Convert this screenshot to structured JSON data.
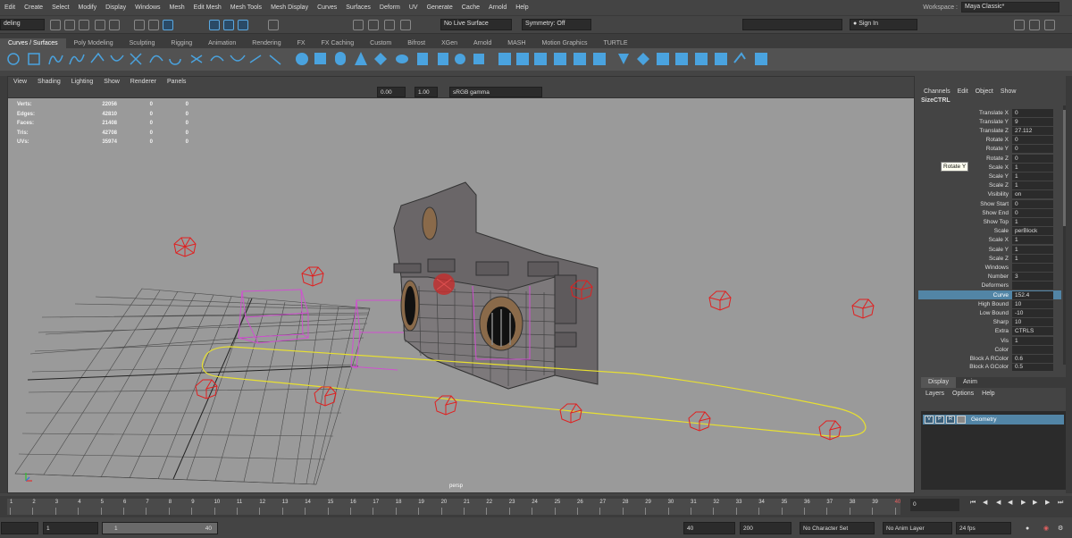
{
  "menus": [
    "Edit",
    "Create",
    "Select",
    "Modify",
    "Display",
    "Windows",
    "Mesh",
    "Edit Mesh",
    "Mesh Tools",
    "Mesh Display",
    "Curves",
    "Surfaces",
    "Deform",
    "UV",
    "Generate",
    "Cache",
    "Arnold",
    "Help"
  ],
  "workspace": {
    "label": "Workspace :",
    "value": "Maya Classic*"
  },
  "status": {
    "menuset": "deling",
    "live": "No Live Surface",
    "symmetry": "Symmetry: Off",
    "signin": "Sign In"
  },
  "shelf_tabs": [
    "Curves / Surfaces",
    "Poly Modeling",
    "Sculpting",
    "Rigging",
    "Animation",
    "Rendering",
    "FX",
    "FX Caching",
    "Custom",
    "Bifrost",
    "XGen",
    "Arnold",
    "MASH",
    "Motion Graphics",
    "TURTLE"
  ],
  "viewport": {
    "menus": [
      "View",
      "Shading",
      "Lighting",
      "Show",
      "Renderer",
      "Panels"
    ],
    "gamma_a": "0.00",
    "gamma_b": "1.00",
    "colorspace": "sRGB gamma",
    "hud": [
      [
        "Verts:",
        "22056",
        "0",
        "0"
      ],
      [
        "Edges:",
        "42810",
        "0",
        "0"
      ],
      [
        "Faces:",
        "21408",
        "0",
        "0"
      ],
      [
        "Tris:",
        "42708",
        "0",
        "0"
      ],
      [
        "UVs:",
        "35974",
        "0",
        "0"
      ]
    ],
    "camera": "persp"
  },
  "channelbox": {
    "menus": [
      "Channels",
      "Edit",
      "Object",
      "Show"
    ],
    "object": "SizeCTRL",
    "attrs": [
      [
        "Translate X",
        "0"
      ],
      [
        "Translate Y",
        "9"
      ],
      [
        "Translate Z",
        "27.112"
      ],
      [
        "Rotate X",
        "0"
      ],
      [
        "Rotate Y",
        "0"
      ],
      [
        "Rotate Z",
        "0"
      ],
      [
        "Scale X",
        "1"
      ],
      [
        "Scale Y",
        "1"
      ],
      [
        "Scale Z",
        "1"
      ],
      [
        "Visibility",
        "on"
      ],
      [
        "Show Start",
        "0"
      ],
      [
        "Show End",
        "0"
      ],
      [
        "Show Top",
        "1"
      ],
      [
        "Scale",
        "perBlock"
      ],
      [
        "Scale X",
        "1"
      ],
      [
        "Scale Y",
        "1"
      ],
      [
        "Scale Z",
        "1"
      ],
      [
        "Windows",
        ""
      ],
      [
        "Number",
        "3"
      ],
      [
        "Deformers",
        ""
      ],
      [
        "Curve",
        "152.4"
      ],
      [
        "High Bound",
        "10"
      ],
      [
        "Low Bound",
        "-10"
      ],
      [
        "Sharp",
        "10"
      ],
      [
        "Extra",
        "CTRLS"
      ],
      [
        "Vis",
        "1"
      ],
      [
        "Color",
        ""
      ],
      [
        "Block A RColor",
        "0.6"
      ],
      [
        "Block A GColor",
        "0.5"
      ]
    ],
    "tooltip": "Rotate Y"
  },
  "layers": {
    "tabs": [
      "Display",
      "Anim"
    ],
    "menus": [
      "Layers",
      "Options",
      "Help"
    ],
    "row": {
      "v": "V",
      "p": "P",
      "r": "R",
      "name": "Geometry"
    }
  },
  "timeline": {
    "ticks": [
      "1",
      "2",
      "3",
      "4",
      "5",
      "6",
      "7",
      "8",
      "9",
      "10",
      "11",
      "12",
      "13",
      "14",
      "15",
      "16",
      "17",
      "18",
      "19",
      "20",
      "21",
      "22",
      "23",
      "24",
      "25",
      "26",
      "27",
      "28",
      "29",
      "30",
      "31",
      "32",
      "33",
      "34",
      "35",
      "36",
      "37",
      "38",
      "39",
      "40"
    ],
    "current": "0"
  },
  "range": {
    "start": "1",
    "inner_start": "1",
    "inner_end": "40",
    "end": "40",
    "anim_end": "200",
    "character": "No Character Set",
    "anim_layer": "No Anim Layer",
    "fps": "24 fps"
  }
}
